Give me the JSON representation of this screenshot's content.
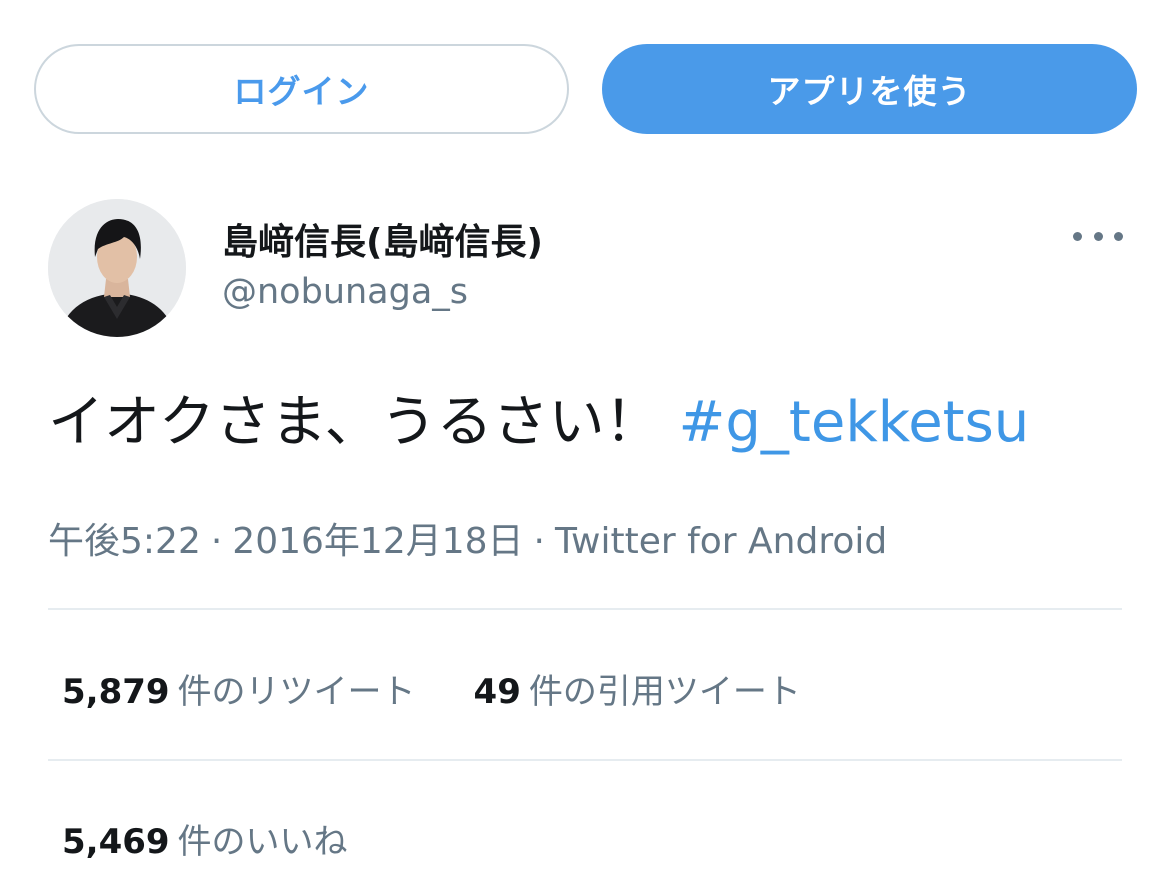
{
  "header": {
    "login_label": "ログイン",
    "app_label": "アプリを使う"
  },
  "tweet": {
    "author": {
      "display_name": "島﨑信長(島﨑信長)",
      "handle": "@nobunaga_s",
      "avatar_icon": "avatar-photo"
    },
    "more_icon": "more-horizontal-icon",
    "text": "イオクさま、うるさい！",
    "hashtag": "#g_tekketsu",
    "time": "午後5:22",
    "date": "2016年12月18日",
    "source": "Twitter for Android",
    "separator": "·"
  },
  "stats": {
    "retweets": {
      "count": "5,879",
      "label": "件のリツイート"
    },
    "quotes": {
      "count": "49",
      "label": "件の引用ツイート"
    },
    "likes": {
      "count": "5,469",
      "label": "件のいいね"
    }
  },
  "colors": {
    "accent": "#4a9ae9",
    "hashtag": "#3f97e6",
    "secondary_text": "#657786",
    "divider": "#e6ecf0"
  }
}
